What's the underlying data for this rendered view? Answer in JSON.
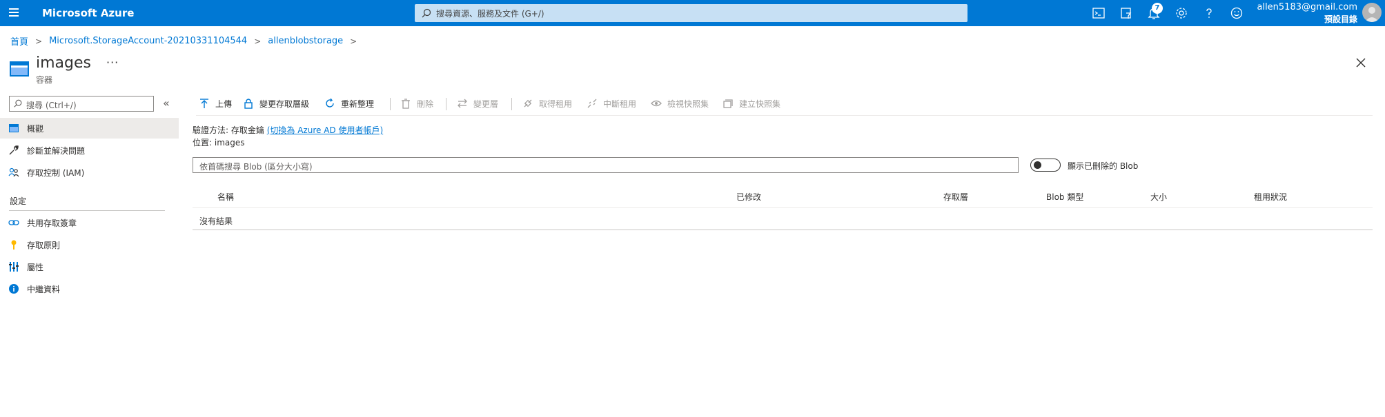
{
  "app": {
    "brand": "Microsoft Azure"
  },
  "search": {
    "placeholder": "搜尋資源、服務及文件 (G+/)"
  },
  "topbar": {
    "notification_count": "7"
  },
  "account": {
    "email": "allen5183@gmail.com",
    "directory": "預設目錄"
  },
  "breadcrumb": [
    "首頁",
    "Microsoft.StorageAccount-20210331104544",
    "allenblobstorage"
  ],
  "page": {
    "title": "images",
    "subtitle": "容器",
    "ellipsis": "···"
  },
  "sidebar": {
    "search_placeholder": "搜尋 (Ctrl+/)",
    "collapse_glyph": "«",
    "items": [
      {
        "label": "概觀"
      },
      {
        "label": "診斷並解決問題"
      },
      {
        "label": "存取控制 (IAM)"
      }
    ],
    "section_label": "設定",
    "settings": [
      {
        "label": "共用存取簽章"
      },
      {
        "label": "存取原則"
      },
      {
        "label": "屬性"
      },
      {
        "label": "中繼資料"
      }
    ]
  },
  "commands": {
    "upload": "上傳",
    "change_tier": "變更存取層級",
    "refresh": "重新整理",
    "delete": "刪除",
    "change_layer": "變更層",
    "acquire_lease": "取得租用",
    "break_lease": "中斷租用",
    "view_snapshots": "檢視快照集",
    "create_snapshot": "建立快照集"
  },
  "info": {
    "auth_label": "驗證方法:",
    "auth_value": "存取金鑰",
    "auth_link": "(切換為 Azure AD 使用者帳戶)",
    "location_label": "位置:",
    "location_value": "images"
  },
  "filter": {
    "placeholder": "依首碼搜尋 Blob (區分大小寫)"
  },
  "toggle": {
    "label": "顯示已刪除的 Blob"
  },
  "table": {
    "headers": [
      "名稱",
      "已修改",
      "存取層",
      "Blob 類型",
      "大小",
      "租用狀況"
    ],
    "empty_text": "沒有結果"
  }
}
